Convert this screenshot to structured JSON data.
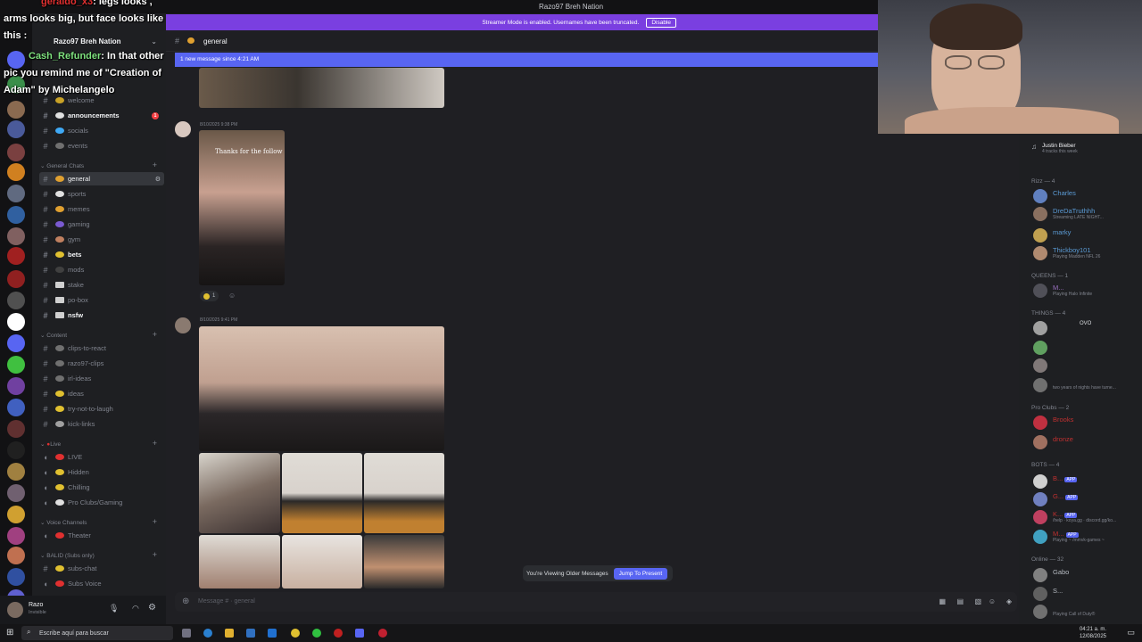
{
  "window": {
    "title": "Razo97 Breh Nation"
  },
  "streamer_banner": {
    "text": "Streamer Mode is enabled. Usernames have been truncated.",
    "disable_label": "Disable"
  },
  "overlay_chat": [
    {
      "user": "geraldo_x3",
      "text": ": legs looks ,"
    },
    {
      "user": "",
      "text": "arms looks big, but face looks like"
    },
    {
      "user": "",
      "text": "this :"
    },
    {
      "user": "Cash_Refunder",
      "text": ": In that other"
    },
    {
      "user": "",
      "text": "pic you remind me of \"Creation of"
    },
    {
      "user": "",
      "text": "Adam\" by Michelangelo"
    }
  ],
  "server": {
    "name": "Razo97 Breh Nation"
  },
  "channels": {
    "top": [
      {
        "name": "welcome",
        "style": "muted"
      },
      {
        "name": "announcements",
        "style": "bold",
        "badge": "1"
      },
      {
        "name": "socials",
        "style": "muted"
      },
      {
        "name": "events",
        "style": "muted"
      }
    ],
    "general_category": "General Chats",
    "general": [
      {
        "name": "general",
        "style": "selected"
      },
      {
        "name": "sports",
        "style": "muted"
      },
      {
        "name": "memes",
        "style": "muted"
      },
      {
        "name": "gaming",
        "style": "muted"
      },
      {
        "name": "gym",
        "style": "muted"
      },
      {
        "name": "bets",
        "style": "bold"
      },
      {
        "name": "mods",
        "style": "muted"
      },
      {
        "name": "stake",
        "style": "muted"
      },
      {
        "name": "po-box",
        "style": "muted"
      },
      {
        "name": "nsfw",
        "style": "bold"
      }
    ],
    "content_category": "Content",
    "content": [
      {
        "name": "clips-to-react"
      },
      {
        "name": "razo97-clips"
      },
      {
        "name": "irl-ideas"
      },
      {
        "name": "ideas"
      },
      {
        "name": "try-not-to-laugh"
      },
      {
        "name": "kick-links"
      }
    ],
    "live_category": "Live",
    "live": [
      {
        "name": "LIVE"
      },
      {
        "name": "Hidden"
      },
      {
        "name": "Chilling"
      },
      {
        "name": "Pro Clubs/Gaming"
      }
    ],
    "voice_category": "Voice Channels",
    "voice": [
      {
        "name": "Theater"
      }
    ],
    "subs_category": "BALID (Subs only)",
    "subs": [
      {
        "name": "subs-chat"
      },
      {
        "name": "Subs Voice"
      }
    ]
  },
  "chat": {
    "channel": "general",
    "new_message_bar": "1 new message since 4:21 AM",
    "msg1_time": "8/10/2025 9:38 PM",
    "msg1_caption": "Thanks for the follow",
    "msg1_reaction_count": "1",
    "msg2_time": "8/10/2025 9:41 PM",
    "message_placeholder": "Message # · general",
    "older_messages": "You're Viewing Older Messages",
    "jump_label": "Jump To Present"
  },
  "members": {
    "now_playing": {
      "name": "Justin Bieber",
      "sub": "4 tracks this week"
    },
    "rizz_header": "Rizz — 4",
    "rizz": [
      {
        "name": "Charles",
        "sub": ""
      },
      {
        "name": "DreDaTruthhh",
        "sub": "Streaming LATE NIGHT..."
      },
      {
        "name": "marky",
        "sub": ""
      },
      {
        "name": "Thickboy101",
        "sub": "Playing Madden NFL 26"
      }
    ],
    "queens_header": "QUEENS — 1",
    "queens_sub": "Playing Halo Infinite",
    "things_header": "THINGS — 4",
    "things_badge": "OVO",
    "things_sub": "two years of nights have turne...",
    "proclubs_header": "Pro Clubs — 2",
    "proclubs": [
      {
        "name": "Brooks"
      },
      {
        "name": "dronze"
      }
    ],
    "bots_header": "BOTS — 4",
    "bots_app": "APP",
    "bots_sub1": "/help · koya.gg · discord.gg/ko...",
    "bots_sub2": "Playing ~ /mmvk-games ~",
    "online_header": "Online — 32",
    "online": [
      {
        "name": "Gabo"
      },
      {
        "name": "S..."
      }
    ],
    "online_sub": "Playing Call of Duty®"
  },
  "user": {
    "name": "Razo",
    "status": "Invisible"
  },
  "taskbar": {
    "search_placeholder": "Escribe aquí para buscar",
    "time": "04:21 a. m.",
    "date": "12/08/2025"
  }
}
